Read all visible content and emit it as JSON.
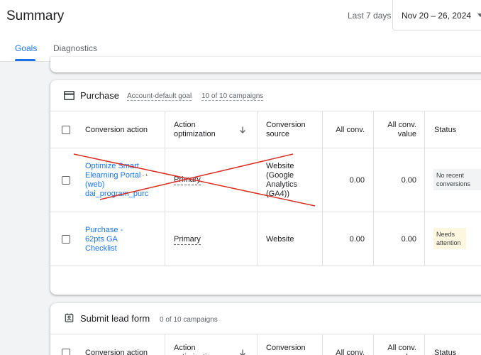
{
  "header": {
    "title": "Summary",
    "range_label": "Last 7 days",
    "date_range": "Nov 20 – 26, 2024"
  },
  "tabs": [
    "Goals",
    "Diagnostics"
  ],
  "columns": {
    "conversion_action": "Conversion action",
    "action_optimization": "Action optimization",
    "conversion_source": "Conversion source",
    "all_conv": "All conv.",
    "all_conv_value": "All conv. value",
    "status": "Status"
  },
  "purchase": {
    "name": "Purchase",
    "goal_type": "Account-default goal",
    "campaigns": "10 of 10 campaigns",
    "rows": [
      {
        "action_name": "Optimize Smart Elearning Portal",
        "action_suffix": " - ¹",
        "action_tag": "(web) dai_program_purc",
        "optimization": "Primary",
        "source": "Website (Google Analytics (GA4))",
        "all_conv": "0.00",
        "all_conv_value": "0.00",
        "status": "No recent conversions",
        "crossed_out": true
      },
      {
        "action_name": "Purchase - 62pts GA Checklist",
        "optimization": "Primary",
        "source": "Website",
        "all_conv": "0.00",
        "all_conv_value": "0.00",
        "status": "Needs attention"
      }
    ]
  },
  "lead": {
    "name": "Submit lead form",
    "campaigns": "0 of 10 campaigns"
  },
  "colors": {
    "accent": "#1a73e8",
    "cross": "#d93025",
    "warning_bg": "#fef7e0"
  }
}
